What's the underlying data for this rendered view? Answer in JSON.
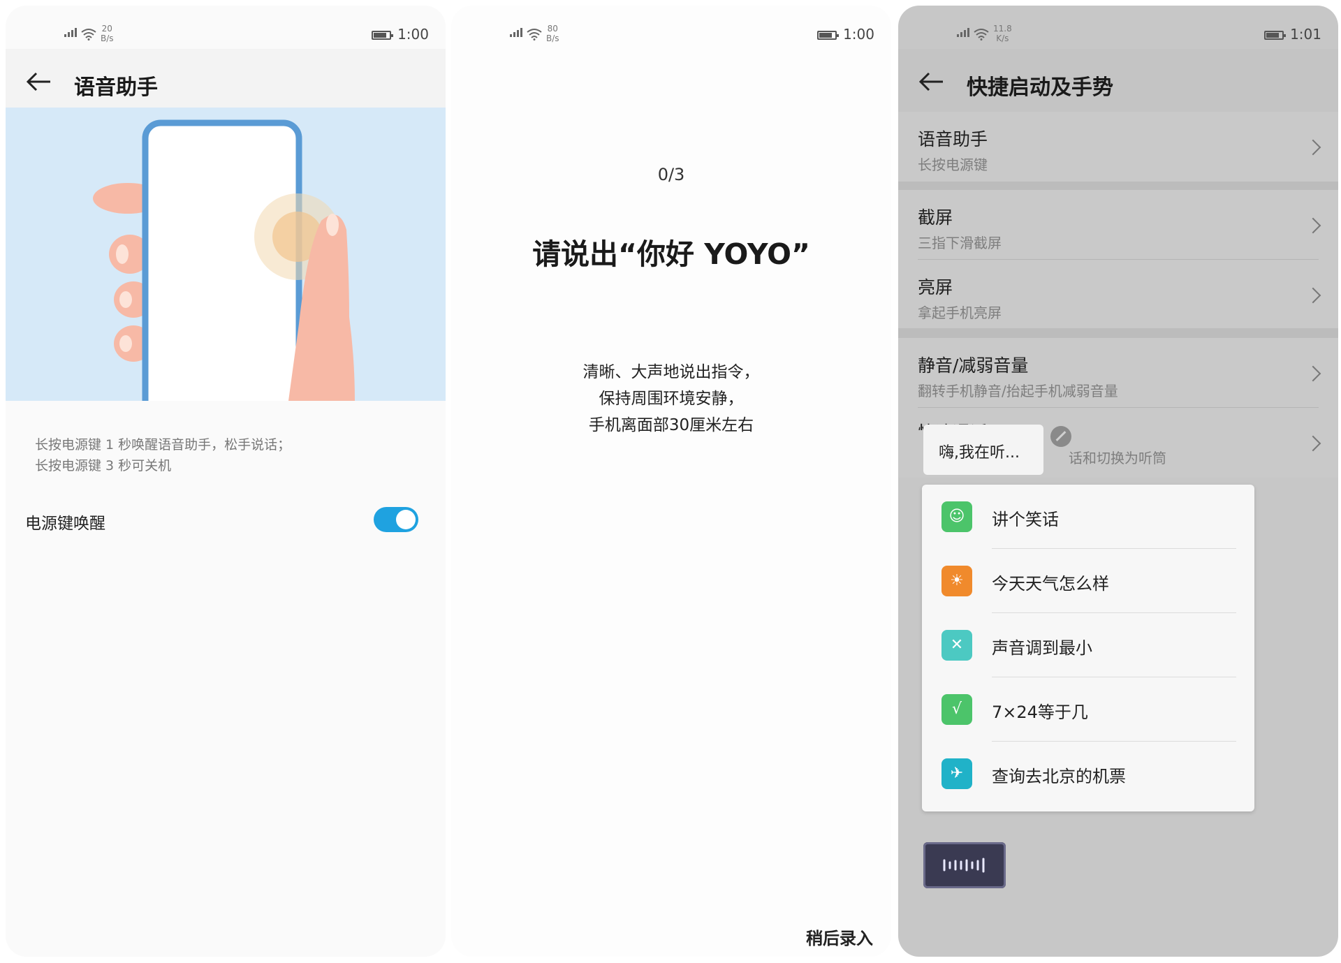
{
  "panel1": {
    "status": {
      "net_top": "20",
      "net_bottom": "B/s",
      "net_type": "2G",
      "time": "1:00"
    },
    "title": "语音助手",
    "description": [
      "长按电源键 1 秒唤醒语音助手，松手说话；",
      "长按电源键 3 秒可关机"
    ],
    "toggle": {
      "label": "电源键唤醒",
      "on": true
    },
    "colors": {
      "accent": "#1fa2e0",
      "hero_bg": "#d6e9f8"
    }
  },
  "panel2": {
    "status": {
      "net_top": "80",
      "net_bottom": "B/s",
      "net_type": "2G",
      "time": "1:00"
    },
    "counter": "0/3",
    "prompt": "请说出“你好 YOYO”",
    "instructions": [
      "清晰、大声地说出指令，",
      "保持周围环境安静，",
      "手机离面部30厘米左右"
    ],
    "later_button": "稍后录入"
  },
  "panel3": {
    "status": {
      "net_top": "11.8",
      "net_bottom": "K/s",
      "net_type": "2G",
      "time": "1:01"
    },
    "title": "快捷启动及手势",
    "items": [
      {
        "title": "语音助手",
        "subtitle": "长按电源键"
      },
      {
        "title": "截屏",
        "subtitle": "三指下滑截屏"
      },
      {
        "title": "亮屏",
        "subtitle": "拿起手机亮屏"
      },
      {
        "title": "静音/减弱音量",
        "subtitle": "翻转手机静音/抬起手机减弱音量"
      },
      {
        "title": "快速通话",
        "subtitle": "话和切换为听筒"
      }
    ],
    "bubble": "嗨,我在听...",
    "suggestions": [
      {
        "label": "讲个笑话",
        "icon": "joke-icon",
        "color": "#4cc46a",
        "glyph": "☺"
      },
      {
        "label": "今天天气怎么样",
        "icon": "weather-icon",
        "color": "#f08a2c",
        "glyph": "☀"
      },
      {
        "label": "声音调到最小",
        "icon": "mute-icon",
        "color": "#4cc9c2",
        "glyph": "✕"
      },
      {
        "label": "7×24等于几",
        "icon": "calculator-icon",
        "color": "#4cc46a",
        "glyph": "√"
      },
      {
        "label": "查询去北京的机票",
        "icon": "camel-icon",
        "color": "#20b2c8",
        "glyph": "✈"
      }
    ]
  }
}
